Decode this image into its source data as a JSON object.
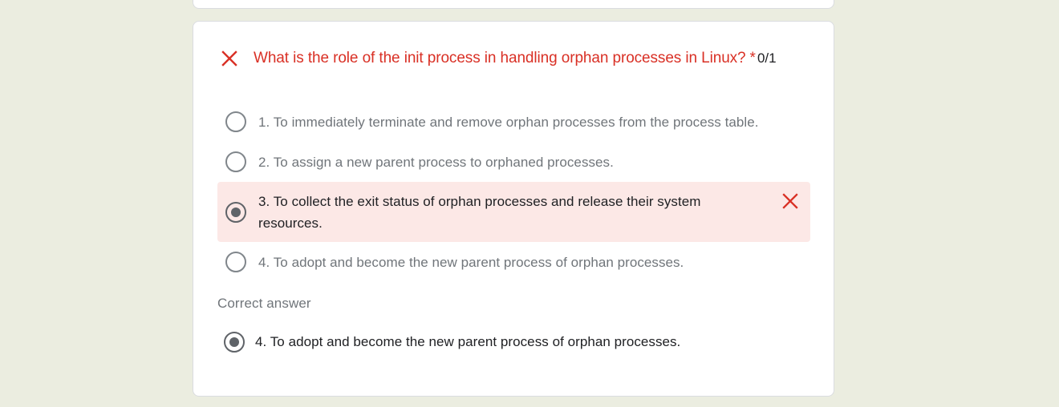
{
  "question": {
    "text": "What is the role of the init process in handling orphan processes in Linux?",
    "required_mark": "*",
    "score": "0/1",
    "status_icon": "close-icon",
    "status_color": "#d93025"
  },
  "options": [
    {
      "label": "1. To immediately terminate and remove orphan processes from the process table.",
      "selected": false
    },
    {
      "label": "2. To assign a new parent process to orphaned processes.",
      "selected": false
    },
    {
      "label": "3. To collect the exit status of orphan processes and release their system resources.",
      "selected": true,
      "marked_wrong": true
    },
    {
      "label": "4. To adopt and become the new parent process of orphan processes.",
      "selected": false
    }
  ],
  "correct_answer": {
    "heading": "Correct answer",
    "label": "4. To adopt and become the new parent process of orphan processes."
  },
  "colors": {
    "error": "#d93025",
    "wrong_bg": "#fce8e6",
    "page_bg": "#ebede0"
  }
}
